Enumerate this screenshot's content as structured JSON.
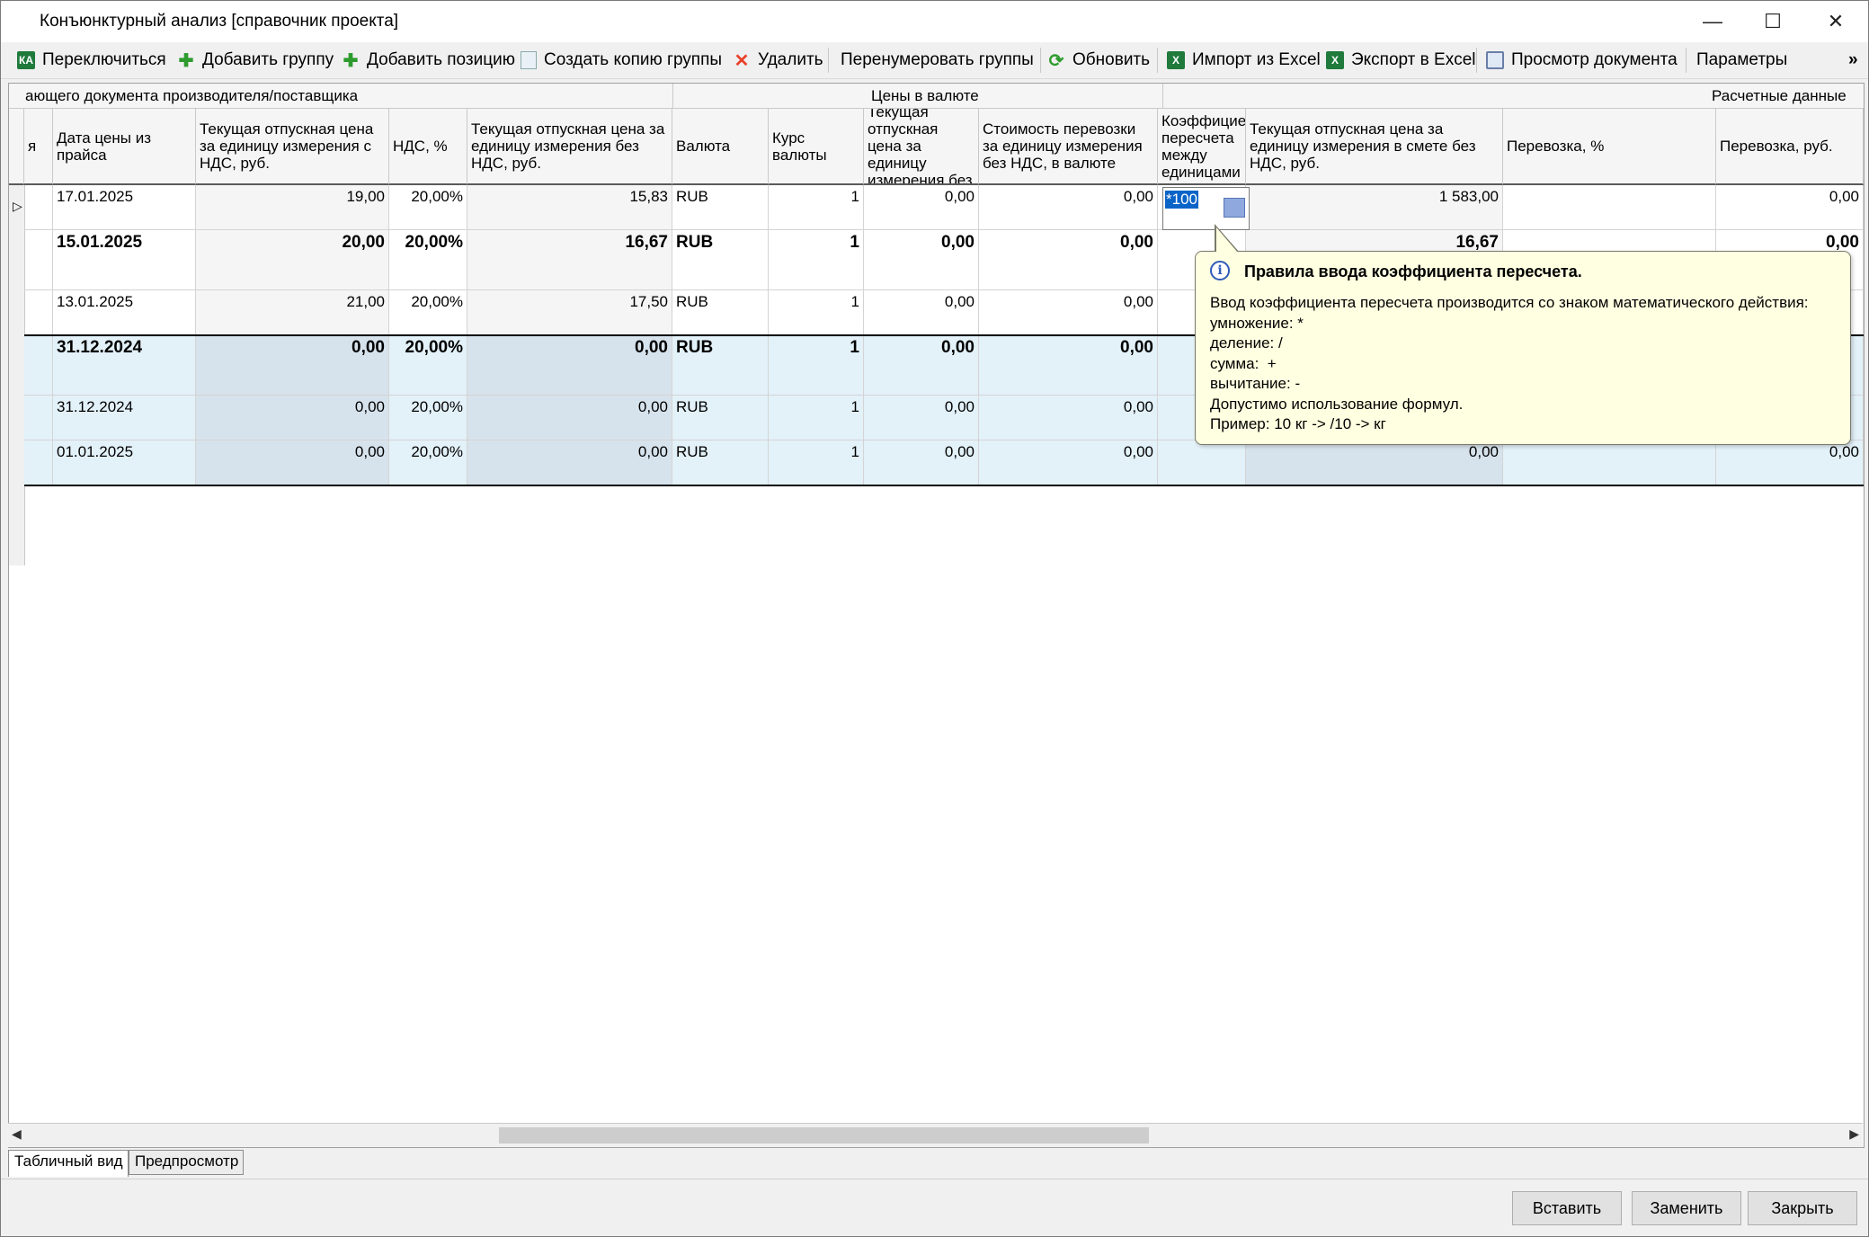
{
  "window": {
    "title": "Конъюнктурный анализ [справочник проекта]",
    "minimize_icon": "minimize-icon",
    "maximize_icon": "maximize-icon",
    "close_icon": "close-icon"
  },
  "toolbar": {
    "switch": "Переключиться",
    "add_group": "Добавить группу",
    "add_position": "Добавить позицию",
    "copy_group": "Создать копию группы",
    "delete": "Удалить",
    "renumber": "Перенумеровать группы",
    "refresh": "Обновить",
    "import_excel": "Импорт из Excel",
    "export_excel": "Экспорт в Excel",
    "view_doc": "Просмотр документа",
    "params": "Параметры",
    "more": "»"
  },
  "bands": {
    "supplier": "ающего документа производителя/поставщика",
    "currency_prices": "Цены в валюте",
    "calc": "Расчетные данные"
  },
  "columns": {
    "c0": "я",
    "date": "Дата цены из прайса",
    "price_vat": "Текущая отпускная цена за единицу измерения с НДС, руб.",
    "vat": "НДС, %",
    "price_novat": "Текущая отпускная цена за единицу измерения без НДС, руб.",
    "currency": "Валюта",
    "rate": "Курс валюты",
    "cur_price": "Текущая отпускная цена за единицу измерения без",
    "transport_cost": "Стоимость перевозки за единицу измерения без НДС, в валюте",
    "coef": "Коэффициент пересчета между единицами",
    "estimate_price": "Текущая отпускная цена за единицу измерения в смете без НДС, руб.",
    "transport_pct": "Перевозка, %",
    "transport_rub": "Перевозка, руб."
  },
  "rows": [
    {
      "date": "17.01.2025",
      "price_vat": "19,00",
      "vat": "20,00%",
      "price_novat": "15,83",
      "currency": "RUB",
      "rate": "1",
      "cur_price": "0,00",
      "transport": "0,00",
      "coef": "*100",
      "estimate": "1 583,00",
      "pct": "",
      "rub": "0,00"
    },
    {
      "date": "15.01.2025",
      "price_vat": "20,00",
      "vat": "20,00%",
      "price_novat": "16,67",
      "currency": "RUB",
      "rate": "1",
      "cur_price": "0,00",
      "transport": "0,00",
      "coef": "",
      "estimate": "16,67",
      "pct": "",
      "rub": "0,00"
    },
    {
      "date": "13.01.2025",
      "price_vat": "21,00",
      "vat": "20,00%",
      "price_novat": "17,50",
      "currency": "RUB",
      "rate": "1",
      "cur_price": "0,00",
      "transport": "0,00",
      "coef": "",
      "estimate": "",
      "pct": "",
      "rub": ""
    },
    {
      "date": "31.12.2024",
      "price_vat": "0,00",
      "vat": "20,00%",
      "price_novat": "0,00",
      "currency": "RUB",
      "rate": "1",
      "cur_price": "0,00",
      "transport": "0,00",
      "coef": "",
      "estimate": "",
      "pct": "",
      "rub": ""
    },
    {
      "date": "31.12.2024",
      "price_vat": "0,00",
      "vat": "20,00%",
      "price_novat": "0,00",
      "currency": "RUB",
      "rate": "1",
      "cur_price": "0,00",
      "transport": "0,00",
      "coef": "",
      "estimate": "",
      "pct": "",
      "rub": ""
    },
    {
      "date": "01.01.2025",
      "price_vat": "0,00",
      "vat": "20,00%",
      "price_novat": "0,00",
      "currency": "RUB",
      "rate": "1",
      "cur_price": "0,00",
      "transport": "0,00",
      "coef": "",
      "estimate": "0,00",
      "pct": "",
      "rub": "0,00"
    }
  ],
  "tooltip": {
    "title": "Правила ввода коэффициента пересчета.",
    "body": "Ввод коэффициента пересчета производится со знаком математического действия:\nумножение: *\nделение: /\nсумма:  +\nвычитание: -\nДопустимо использование формул.\nПример: 10 кг -> /10 -> кг",
    "icon": "info-icon"
  },
  "tabs": {
    "table": "Табличный вид",
    "preview": "Предпросмотр"
  },
  "buttons": {
    "insert": "Вставить",
    "replace": "Заменить",
    "close": "Закрыть"
  }
}
